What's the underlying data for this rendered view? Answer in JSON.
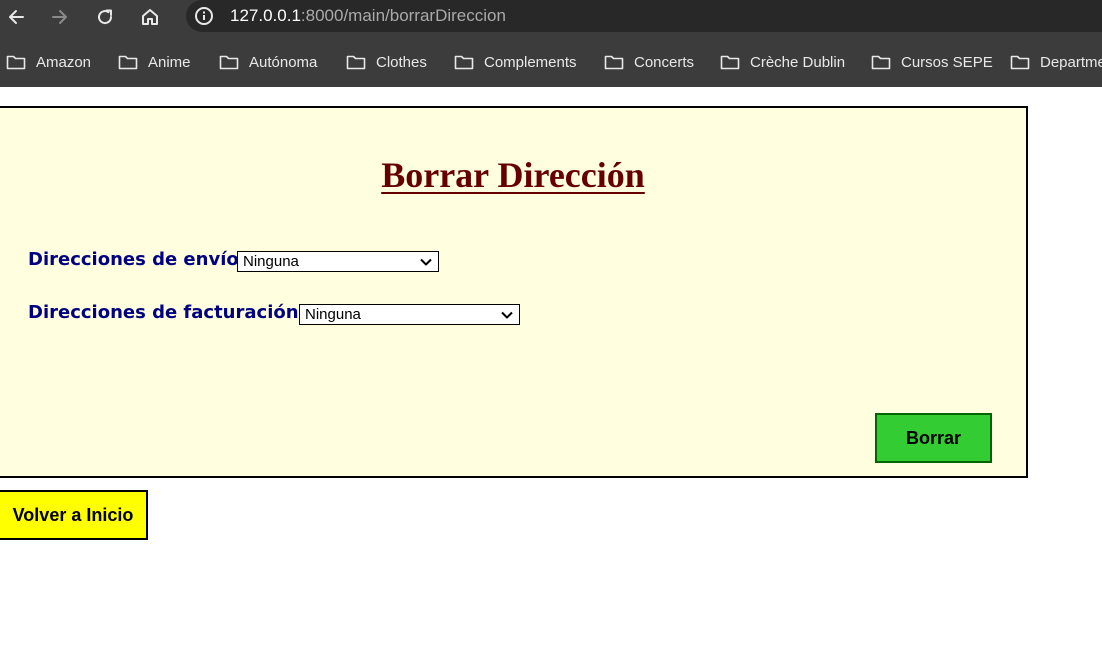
{
  "browser": {
    "url_host": "127.0.0.1",
    "url_path": ":8000/main/borrarDireccion",
    "icons": [
      "back-icon",
      "forward-icon",
      "reload-icon",
      "home-icon",
      "info-icon",
      "folder-icon"
    ],
    "colors": {
      "toolbar": "#3c3c3c",
      "omnibox": "#282828"
    }
  },
  "bookmarks": [
    "Amazon",
    "Anime",
    "Autónoma",
    "Clothes",
    "Complements",
    "Concerts",
    "Crèche Dublin",
    "Cursos SEPE",
    "Department"
  ],
  "page": {
    "title": "Borrar Dirección",
    "shipping": {
      "label": "Direcciones de envío:",
      "selected": "Ninguna"
    },
    "billing": {
      "label": "Direcciones de facturación:",
      "selected": "Ninguna"
    },
    "delete_button": "Borrar",
    "home_button": "Volver a Inicio",
    "colors": {
      "card_bg": "#ffffe0",
      "title": "#660000",
      "labels": "#000080",
      "delete_button": "#33cc33",
      "home_button": "#ffff00"
    }
  }
}
